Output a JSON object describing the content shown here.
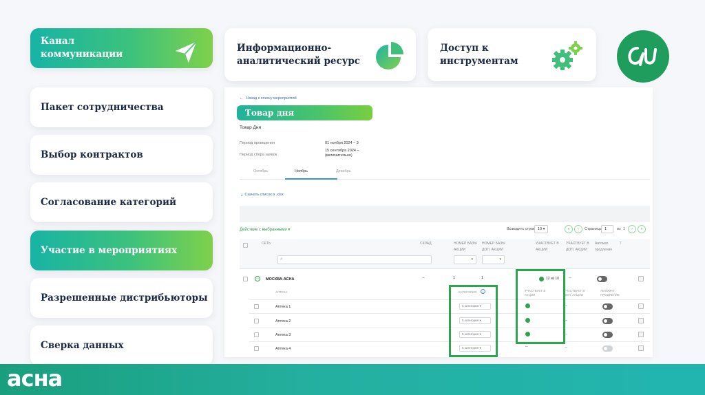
{
  "sidebar": {
    "items": [
      {
        "label_line1": "Канал",
        "label_line2": "коммуникации",
        "active": true
      },
      {
        "label": "Пакет сотрудничества"
      },
      {
        "label": "Выбор контрактов"
      },
      {
        "label": "Согласование категорий"
      },
      {
        "label": "Участие в мероприятиях",
        "active": true
      },
      {
        "label": "Разрешенные дистрибьюторы"
      },
      {
        "label": "Сверка данных"
      }
    ]
  },
  "top_cards": [
    {
      "line1": "Информационно-",
      "line2": "аналитический ресурс",
      "icon": "pie-chart-icon"
    },
    {
      "line1": "Доступ к",
      "line2": "инструментам",
      "icon": "gears-icon"
    }
  ],
  "logo_circle": {
    "icon": "asna-logo-icon"
  },
  "panel": {
    "back_link": "Назад к списку мероприятий",
    "title": "Товар дня",
    "subtitle": "Товар Дня",
    "meta": [
      {
        "label": "Период проведения",
        "value": "01 ноября 2024 – 3"
      },
      {
        "label": "Период сбора заявок",
        "value_line1": "15 сентября 2024 –",
        "value_line2": "(включительно)"
      }
    ],
    "tabs": [
      "Октябрь",
      "Ноябрь",
      "Декабрь"
    ],
    "active_tab": "Ноябрь",
    "download": "Скачать список в .xlsx",
    "action_select": "Действие с выбранными",
    "pager": {
      "per_page_label": "Выводить строк",
      "per_page_value": "10",
      "page_label": "Страница",
      "page_value": "1",
      "of_label": "из",
      "total_pages": "1"
    },
    "table_head": {
      "network": "СЕТЬ",
      "warehouse": "СКЛАД",
      "base_number": [
        "НОМЕР БАЗЫ",
        "АКЦИИ"
      ],
      "extra_number": [
        "НОМЕР БАЗЫ",
        "ДОП. АКЦИИ"
      ],
      "participates": [
        "УЧАСТВУЕТ В",
        "АКЦИИ"
      ],
      "participates_extra": [
        "УЧАСТВУЕТ В",
        "ДОП. АКЦИИ"
      ],
      "auto": [
        "Автомат.",
        "продление"
      ],
      "search_placeholder": ""
    },
    "group_row": {
      "name": "МОСКВА-АСНА",
      "warehouse": "--",
      "base": "1",
      "extra": "1",
      "participates": "12 из 10",
      "participates_extra": "--"
    },
    "sub_head": {
      "pharmacy": "АПТЕКА",
      "category": "КАТЕГОРИЯ",
      "participates": [
        "УЧАСТВУЕТ В",
        "АКЦИИ"
      ],
      "participates_extra": [
        "УЧАСТВУЕТ В",
        "ДОП. АКЦИИ"
      ],
      "auto": [
        "АВТОМАТ.",
        "ПРОДЛЕНИЕ"
      ]
    },
    "rows": [
      {
        "name": "Аптека 1",
        "category": "5 категория",
        "participates": true,
        "extra": "--",
        "auto_on": true
      },
      {
        "name": "Аптека 2",
        "category": "5 категория",
        "participates": true,
        "extra": "--",
        "auto_on": true
      },
      {
        "name": "Аптека 3",
        "category": "5 категория",
        "participates": true,
        "extra": "--",
        "auto_on": true
      },
      {
        "name": "Аптека 4",
        "category": "5 категория",
        "participates": false,
        "participates_text": "--",
        "extra": "--",
        "auto_on": false
      }
    ]
  },
  "brand": "асна",
  "colors": {
    "accent_green": "#2ea44f",
    "gradient_start": "#17b3a5",
    "gradient_end": "#7fd04a",
    "bottom_bar": "#1fa890"
  }
}
